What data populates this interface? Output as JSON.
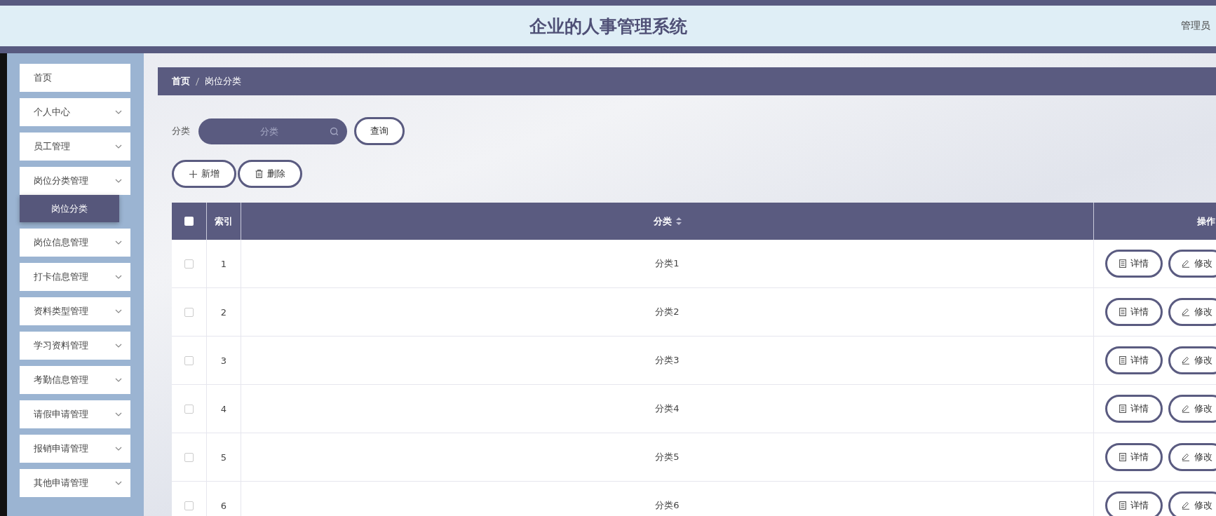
{
  "header": {
    "title": "企业的人事管理系统",
    "user": "管理员"
  },
  "sidebar": {
    "items": [
      {
        "label": "首页",
        "kind": "link"
      },
      {
        "label": "个人中心",
        "kind": "group"
      },
      {
        "label": "员工管理",
        "kind": "group"
      },
      {
        "label": "岗位分类管理",
        "kind": "group",
        "children": [
          {
            "label": "岗位分类",
            "selected": true
          }
        ]
      },
      {
        "label": "岗位信息管理",
        "kind": "group"
      },
      {
        "label": "打卡信息管理",
        "kind": "group"
      },
      {
        "label": "资料类型管理",
        "kind": "group"
      },
      {
        "label": "学习资料管理",
        "kind": "group"
      },
      {
        "label": "考勤信息管理",
        "kind": "group"
      },
      {
        "label": "请假申请管理",
        "kind": "group"
      },
      {
        "label": "报销申请管理",
        "kind": "group"
      },
      {
        "label": "其他申请管理",
        "kind": "group"
      }
    ]
  },
  "breadcrumb": [
    "首页",
    "岗位分类"
  ],
  "search": {
    "label": "分类",
    "placeholder": "分类",
    "button": "查询"
  },
  "actions": [
    {
      "kind": "add",
      "label": "新增"
    },
    {
      "kind": "delete",
      "label": "删除"
    }
  ],
  "table": {
    "columns": [
      {
        "kind": "check"
      },
      {
        "kind": "index",
        "label": "索引"
      },
      {
        "kind": "text",
        "label": "分类",
        "sortable": true
      },
      {
        "kind": "ops",
        "label": "操作"
      }
    ],
    "header_checked": false,
    "rows": [
      {
        "checked": false,
        "index": "1",
        "category": "分类1",
        "buttons": [
          {
            "kind": "detail",
            "label": "详情"
          },
          {
            "kind": "edit",
            "label": "修改"
          }
        ]
      },
      {
        "checked": false,
        "index": "2",
        "category": "分类2",
        "buttons": [
          {
            "kind": "detail",
            "label": "详情"
          },
          {
            "kind": "edit",
            "label": "修改"
          }
        ]
      },
      {
        "checked": false,
        "index": "3",
        "category": "分类3",
        "buttons": [
          {
            "kind": "detail",
            "label": "详情"
          },
          {
            "kind": "edit",
            "label": "修改"
          }
        ]
      },
      {
        "checked": false,
        "index": "4",
        "category": "分类4",
        "buttons": [
          {
            "kind": "detail",
            "label": "详情"
          },
          {
            "kind": "edit",
            "label": "修改"
          }
        ]
      },
      {
        "checked": false,
        "index": "5",
        "category": "分类5",
        "buttons": [
          {
            "kind": "detail",
            "label": "详情"
          },
          {
            "kind": "edit",
            "label": "修改"
          }
        ]
      },
      {
        "checked": false,
        "index": "6",
        "category": "分类6",
        "buttons": [
          {
            "kind": "detail",
            "label": "详情"
          },
          {
            "kind": "edit",
            "label": "修改"
          }
        ]
      }
    ]
  }
}
